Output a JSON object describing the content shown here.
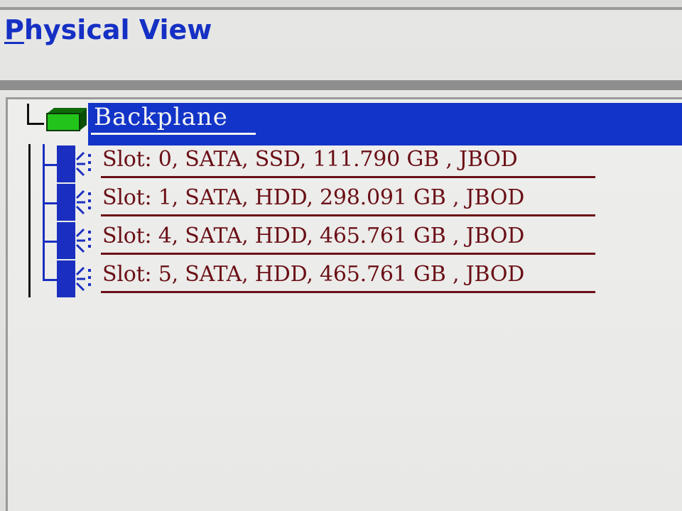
{
  "header": {
    "title_hotkey": "P",
    "title_rest": "hysical View"
  },
  "tree": {
    "root": {
      "label": "Backplane",
      "icon": "backplane-icon",
      "selected": true,
      "icon_color": "#22c31a"
    },
    "drives": [
      {
        "label": "Slot: 0, SATA, SSD, 111.790 GB , JBOD",
        "icon": "drive-icon"
      },
      {
        "label": "Slot: 1, SATA, HDD, 298.091 GB , JBOD",
        "icon": "drive-icon"
      },
      {
        "label": "Slot: 4, SATA, HDD, 465.761 GB , JBOD",
        "icon": "drive-icon"
      },
      {
        "label": "Slot: 5, SATA, HDD, 465.761 GB , JBOD",
        "icon": "drive-icon"
      }
    ]
  },
  "colors": {
    "title": "#1530c4",
    "selection": "#1234c8",
    "drive_text": "#6a0f16",
    "drive_icon": "#1a2fc0"
  }
}
